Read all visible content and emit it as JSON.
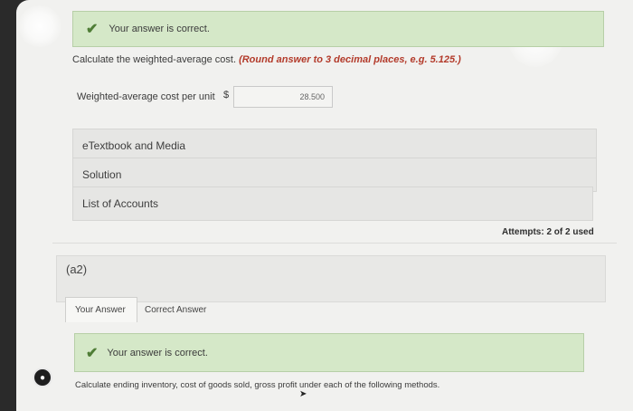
{
  "status_banner_top": {
    "icon": "checkmark-icon",
    "text": "Your answer is correct."
  },
  "question": {
    "text": "Calculate the weighted-average cost.",
    "hint": "(Round answer to 3 decimal places, e.g. 5.125.)",
    "field_label": "Weighted-average cost per unit",
    "currency": "$",
    "answer_value": "28.500"
  },
  "resources": [
    "eTextbook and Media",
    "Solution",
    "List of Accounts"
  ],
  "attempts": "Attempts: 2 of 2 used",
  "part": {
    "label": "(a2)",
    "tabs": [
      "Your Answer",
      "Correct Answer"
    ],
    "status_text": "Your answer is correct.",
    "instruction": "Calculate ending inventory, cost of goods sold, gross profit under each of the following methods."
  },
  "colors": {
    "correct_bg": "#d5e8c8",
    "check": "#4f7d36",
    "hint": "#b33b2b"
  }
}
